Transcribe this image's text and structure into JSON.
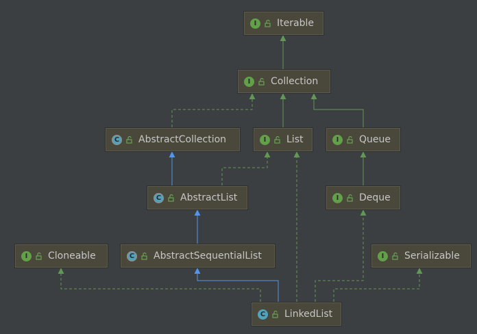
{
  "colors": {
    "background": "#3c3f41",
    "node_fill": "#4a473b",
    "interface_badge": "#62a04a",
    "class_badge": "#4fa3bd",
    "implements_edge": "#629755",
    "extends_edge": "#5394ec",
    "text": "#c7c7c7"
  },
  "nodes": {
    "iterable": {
      "label": "Iterable",
      "kind": "I"
    },
    "collection": {
      "label": "Collection",
      "kind": "I"
    },
    "abstract_collection": {
      "label": "AbstractCollection",
      "kind": "C"
    },
    "list": {
      "label": "List",
      "kind": "I"
    },
    "queue": {
      "label": "Queue",
      "kind": "I"
    },
    "abstract_list": {
      "label": "AbstractList",
      "kind": "C"
    },
    "deque": {
      "label": "Deque",
      "kind": "I"
    },
    "cloneable": {
      "label": "Cloneable",
      "kind": "I"
    },
    "abstract_sequential_list": {
      "label": "AbstractSequentialList",
      "kind": "C"
    },
    "serializable": {
      "label": "Serializable",
      "kind": "I"
    },
    "linked_list": {
      "label": "LinkedList",
      "kind": "C"
    }
  },
  "icons": {
    "interface": "interface-icon",
    "abstract_class": "abstract-class-icon",
    "class": "class-icon",
    "visibility": "unlocked-icon"
  }
}
